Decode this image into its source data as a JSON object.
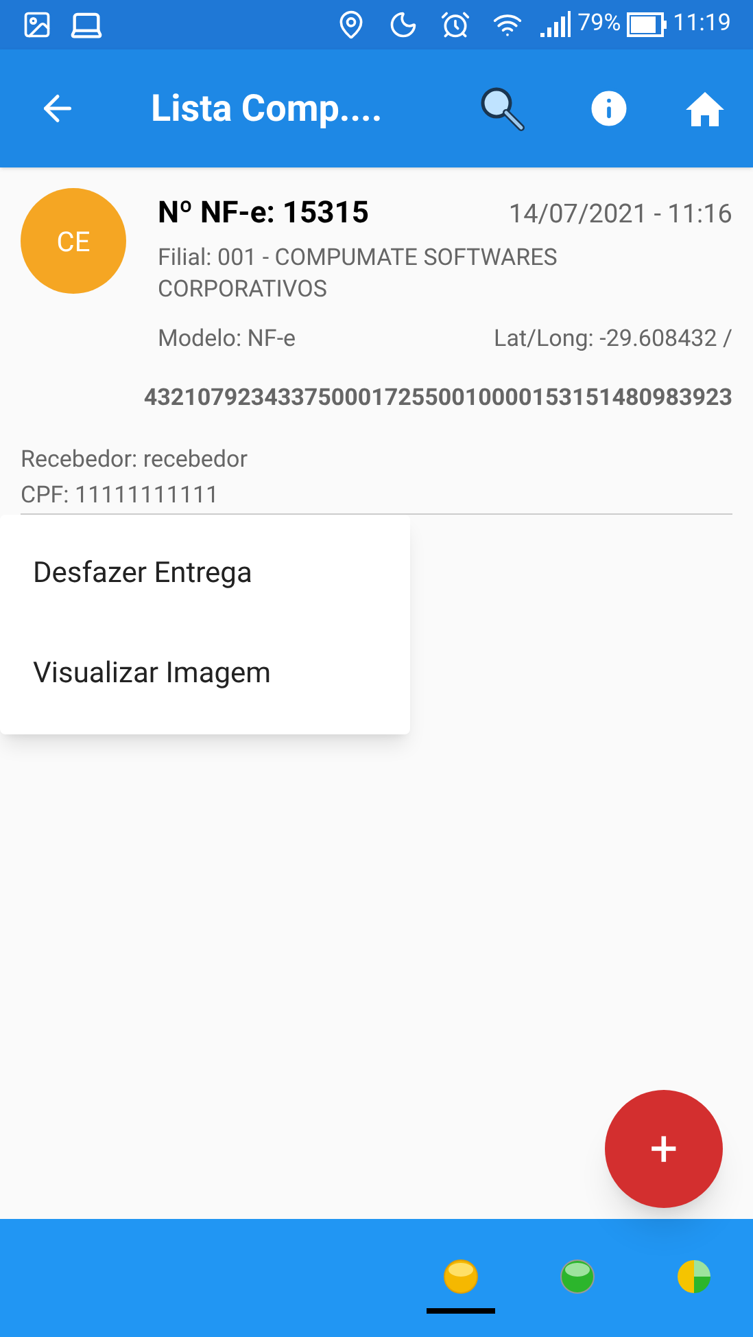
{
  "status_bar": {
    "battery": "79%",
    "time": "11:19"
  },
  "toolbar": {
    "title": "Lista Comp...."
  },
  "card": {
    "avatar": "CE",
    "title": "Nº NF-e: 15315",
    "datetime": "14/07/2021 - 11:16",
    "filial": "Filial: 001 - COMPUMATE SOFTWARES CORPORATIVOS",
    "modelo": "Modelo: NF-e",
    "latlong": "Lat/Long: -29.608432 /",
    "key": "43210792343375000172550010000153151480983923",
    "recebedor": "Recebedor: recebedor",
    "cpf": "CPF: 11111111111"
  },
  "menu": [
    "Desfazer Entrega",
    "Visualizar Imagem"
  ],
  "fab": {
    "label": "+"
  },
  "bottom_tabs": [
    {
      "kind": "yellow",
      "selected": true
    },
    {
      "kind": "green",
      "selected": false
    },
    {
      "kind": "mixed",
      "selected": false
    }
  ]
}
